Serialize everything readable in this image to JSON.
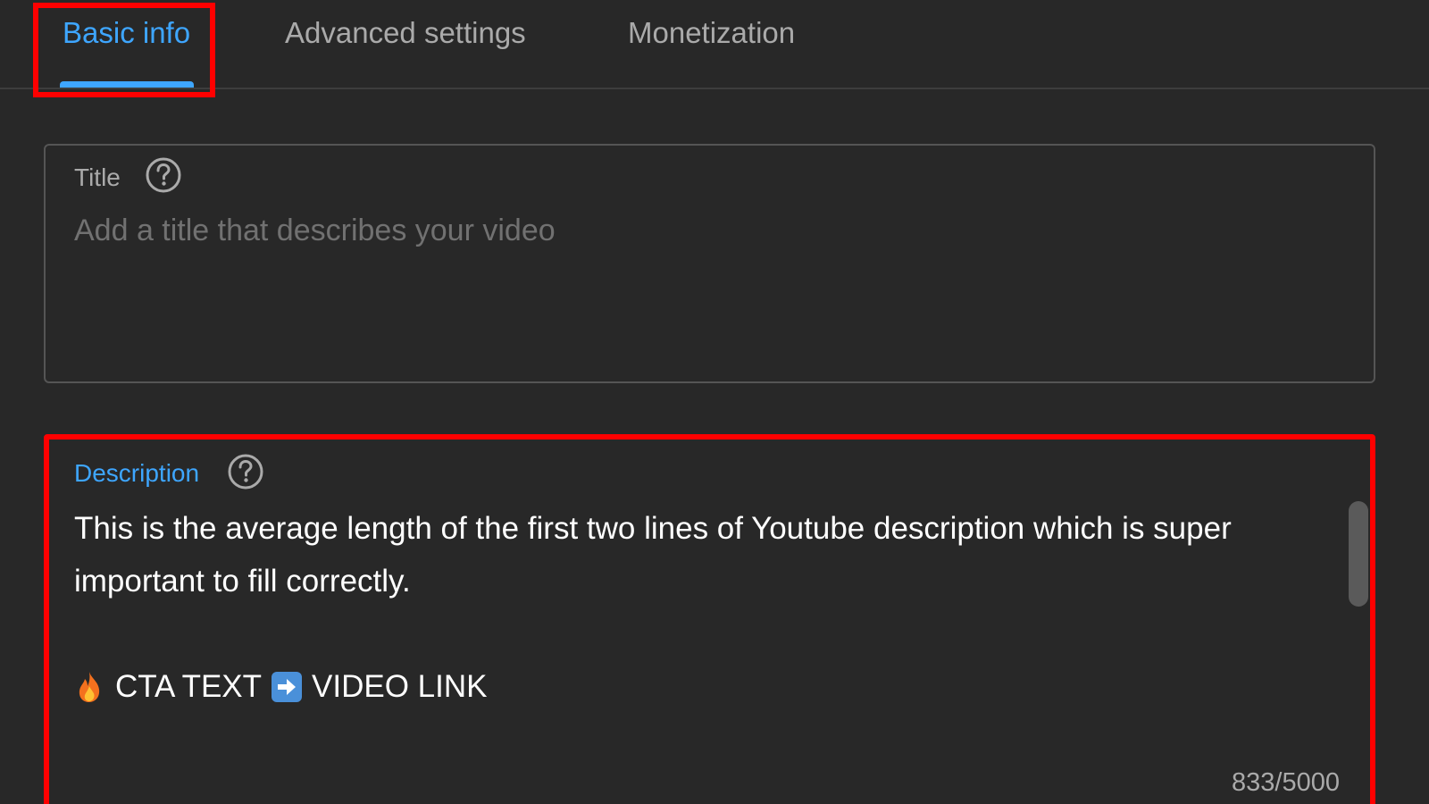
{
  "tabs": [
    {
      "label": "Basic info",
      "active": true
    },
    {
      "label": "Advanced settings",
      "active": false
    },
    {
      "label": "Monetization",
      "active": false
    }
  ],
  "title_field": {
    "label": "Title",
    "placeholder": "Add a title that describes your video",
    "value": ""
  },
  "description_field": {
    "label": "Description",
    "lines": [
      "This is the average length of the first two lines of Youtube description which is super",
      "important to fill correctly."
    ],
    "cta_text": "CTA TEXT",
    "video_link": "VIDEO LINK",
    "char_count": "833/5000"
  },
  "icons": {
    "help": "help-circle-icon",
    "fire": "fire-emoji-icon",
    "arrow": "right-arrow-emoji-icon"
  },
  "colors": {
    "background": "#282828",
    "accent": "#3ea6ff",
    "highlight": "#ff0000",
    "muted_text": "#aaaaaa",
    "placeholder": "#717171"
  }
}
